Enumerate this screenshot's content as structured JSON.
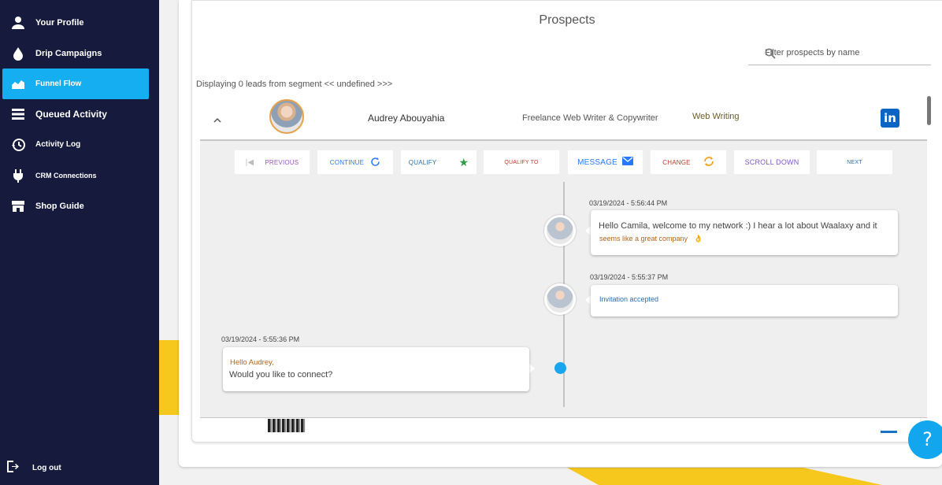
{
  "sidebar": {
    "items": [
      {
        "label": "Your Profile",
        "icon": "user-icon"
      },
      {
        "label": "Drip Campaigns",
        "icon": "drop-icon"
      },
      {
        "label": "Funnel Flow",
        "icon": "chart-icon",
        "active": true
      },
      {
        "label": "Queued Activity",
        "icon": "list-icon"
      },
      {
        "label": "Activity Log",
        "icon": "history-icon"
      },
      {
        "label": "CRM Connections",
        "icon": "plug-icon"
      },
      {
        "label": "Shop Guide",
        "icon": "store-icon"
      }
    ],
    "logout": "Log out"
  },
  "main": {
    "title": "Prospects",
    "filter_placeholder": "Filter prospects by name",
    "displaying": "Displaying 0 leads from segment << undefined >>>",
    "prospect": {
      "name": "Audrey Abouyahia",
      "job": "Freelance Web Writer & Copywriter",
      "tag": "Web Writing"
    },
    "buttons": [
      {
        "label": "PREVIOUS",
        "color": "#9b59b6"
      },
      {
        "label": "CONTINUE",
        "color": "#2979ff"
      },
      {
        "label": "QUALIFY",
        "color": "#2b6fae"
      },
      {
        "label": "QUALIFY TO",
        "color": "#c0392b"
      },
      {
        "label": "MESSAGE",
        "color": "#2979ff"
      },
      {
        "label": "CHANGE",
        "color": "#c0392b"
      },
      {
        "label": "SCROLL DOWN",
        "color": "#7e57c2"
      },
      {
        "label": "NEXT",
        "color": "#2b6fae"
      }
    ],
    "timeline": [
      {
        "timestamp": "03/19/2024 - 5:56:44 PM",
        "line1": "Hello Camila, welcome to my network :) I hear a lot about Waalaxy and it",
        "line2": "seems like a great company",
        "emoji": "👌"
      },
      {
        "timestamp": "03/19/2024 - 5:55:37 PM",
        "text": "Invitation accepted"
      },
      {
        "timestamp": "03/19/2024 - 5:55:36 PM",
        "line1": "Hello Audrey,",
        "line2": "Would you like to connect?"
      }
    ],
    "help": "?"
  },
  "colors": {
    "sidebar_bg": "#161b3d",
    "accent": "#15aef0",
    "yellow": "#f6c71c"
  }
}
